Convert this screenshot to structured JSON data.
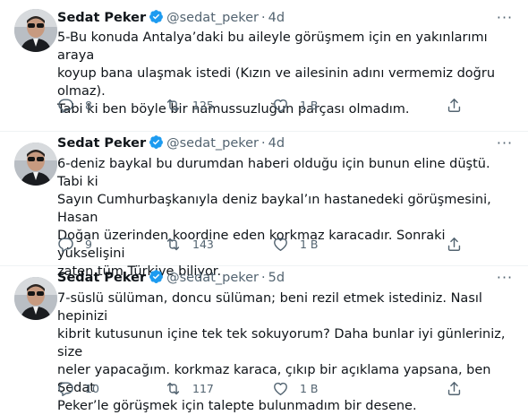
{
  "tweets": [
    {
      "author_name": "Sedat Peker",
      "handle": "@sedat_peker",
      "separator": "·",
      "time": "4d",
      "lines": [
        "5-Bu konuda Antalya’daki bu aileyle görüşmem için en yakınlarımı araya",
        "koyup bana ulaşmak istedi (Kızın ve ailesinin adını vermemiz doğru olmaz).",
        "Tabi ki ben böyle bir namussuzluğun parçası olmadım."
      ],
      "replies": "8",
      "retweets": "125",
      "likes": "1 B"
    },
    {
      "author_name": "Sedat Peker",
      "handle": "@sedat_peker",
      "separator": "·",
      "time": "4d",
      "lines": [
        "6-deniz baykal bu durumdan haberi olduğu için bunun eline düştü. Tabi ki",
        "Sayın Cumhurbaşkanıyla deniz baykal’ın hastanedeki görüşmesini, Hasan",
        "Doğan üzerinden koordine eden korkmaz karacadır. Sonraki yükselişini",
        "zaten tüm Türkiye biliyor."
      ],
      "replies": "9",
      "retweets": "143",
      "likes": "1 B"
    },
    {
      "author_name": "Sedat Peker",
      "handle": "@sedat_peker",
      "separator": "·",
      "time": "5d",
      "lines": [
        "7-süslü sülüman, doncu sülüman; beni rezil etmek istediniz. Nasıl hepinizi",
        "kibrit kutusunun içine tek tek sokuyorum? Daha bunlar iyi günleriniz, size",
        "neler yapacağım. korkmaz karaca, çıkıp bir açıklama yapsana, ben Sedat",
        "Peker’le görüşmek için talepte bulunmadım bir desene."
      ],
      "replies": "10",
      "retweets": "117",
      "likes": "1 B"
    }
  ],
  "more_glyph": "···",
  "icons": [
    "verified-badge-icon",
    "reply-icon",
    "retweet-icon",
    "like-icon",
    "share-icon"
  ],
  "colors": {
    "verified": "#1d9bf0",
    "secondary_text": "#536471",
    "divider": "#eff3f4"
  }
}
